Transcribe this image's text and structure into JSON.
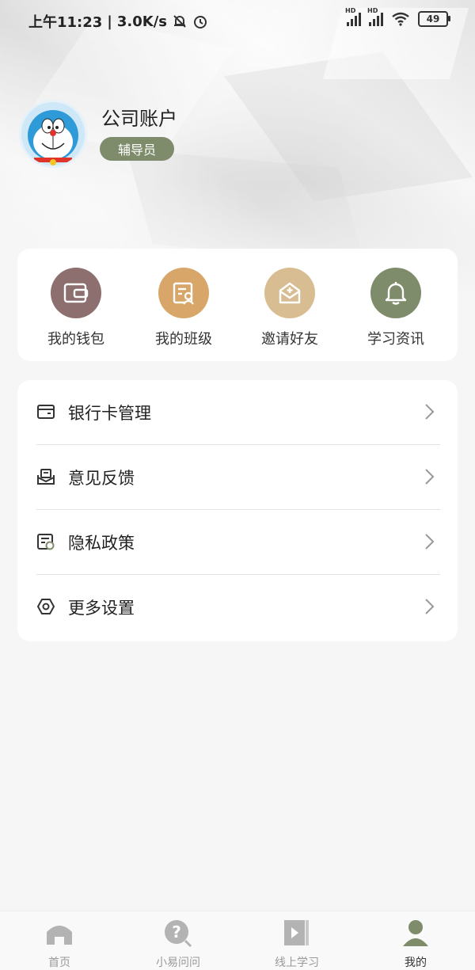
{
  "status_bar": {
    "time": "上午11:23",
    "separator": "|",
    "speed": "3.0K/s",
    "battery": "49",
    "hd1": "HD",
    "hd2": "HD"
  },
  "profile": {
    "name": "公司账户",
    "role": "辅导员"
  },
  "quick_actions": [
    {
      "label": "我的钱包",
      "icon": "wallet-icon",
      "color": "#8c6f6e"
    },
    {
      "label": "我的班级",
      "icon": "class-icon",
      "color": "#d9a66a"
    },
    {
      "label": "邀请好友",
      "icon": "invite-icon",
      "color": "#d8bd92"
    },
    {
      "label": "学习资讯",
      "icon": "bell-icon",
      "color": "#7e8c6b"
    }
  ],
  "menu": [
    {
      "label": "银行卡管理",
      "icon": "card-icon"
    },
    {
      "label": "意见反馈",
      "icon": "feedback-icon"
    },
    {
      "label": "隐私政策",
      "icon": "privacy-icon"
    },
    {
      "label": "更多设置",
      "icon": "settings-icon"
    }
  ],
  "tabs": [
    {
      "label": "首页",
      "icon": "home-icon"
    },
    {
      "label": "小易问问",
      "icon": "question-icon"
    },
    {
      "label": "线上学习",
      "icon": "video-icon"
    },
    {
      "label": "我的",
      "icon": "user-icon",
      "active": true
    }
  ],
  "colors": {
    "accent": "#7e8c6b",
    "background": "#f6f6f6"
  }
}
